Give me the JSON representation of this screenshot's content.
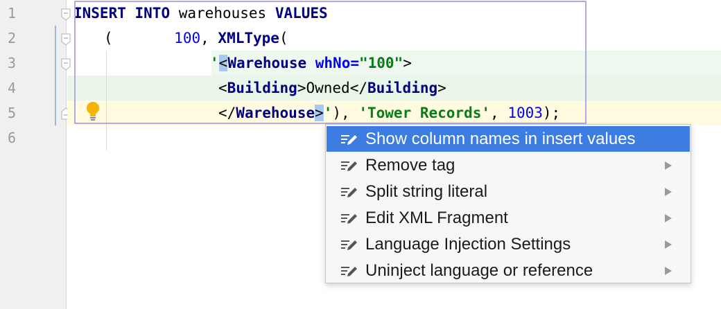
{
  "gutter": {
    "line_numbers": [
      "1",
      "2",
      "3",
      "4",
      "5",
      "6"
    ]
  },
  "code": {
    "line1": {
      "kw1": "INSERT",
      "kw2": "INTO",
      "table": "warehouses",
      "kw3": "VALUES"
    },
    "line2": {
      "paren": "(",
      "num": "100",
      "comma": ",",
      "func": "XMLType",
      "open": "("
    },
    "line3": {
      "quote": "'",
      "lt": "<",
      "tag": "Warehouse",
      "attr": "whNo",
      "eq": "=",
      "attrval": "\"100\"",
      "gt": ">"
    },
    "line4": {
      "lt1": "<",
      "tag1": "Building",
      "gt1": ">",
      "text": "Owned",
      "lt2": "</",
      "tag2": "Building",
      "gt2": ">"
    },
    "line5": {
      "lt": "</",
      "tag": "Warehouse",
      "gt": ">",
      "quote": "'",
      "close": "),",
      "str": "'Tower Records'",
      "comma": ",",
      "num": "1003",
      "end": ");"
    }
  },
  "intention_menu": {
    "items": [
      {
        "label": "Show column names in insert values",
        "selected": true,
        "has_submenu": false
      },
      {
        "label": "Remove tag",
        "selected": false,
        "has_submenu": true
      },
      {
        "label": "Split string literal",
        "selected": false,
        "has_submenu": true
      },
      {
        "label": "Edit XML Fragment",
        "selected": false,
        "has_submenu": true
      },
      {
        "label": "Language Injection Settings",
        "selected": false,
        "has_submenu": true
      },
      {
        "label": "Uninject language or reference",
        "selected": false,
        "has_submenu": true
      }
    ],
    "item_icon": "edit-pencil-icon",
    "submenu_icon": "triangle-right-icon"
  },
  "colors": {
    "keyword": "#000080",
    "number": "#0000ff",
    "string": "#067d17",
    "menu_selected": "#3d7ce0",
    "bulb": "#f5b400"
  }
}
